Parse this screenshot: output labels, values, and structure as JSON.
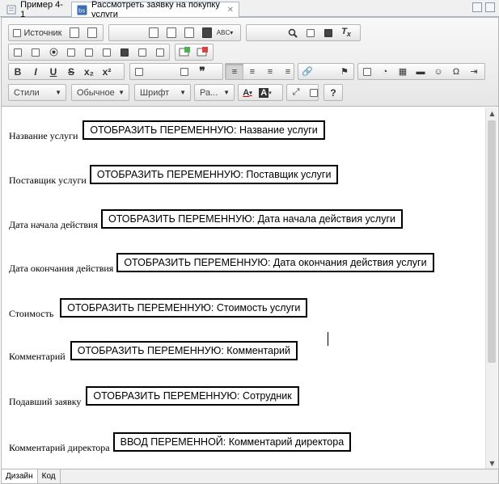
{
  "tabs": [
    {
      "label": "Пример 4-1",
      "active": false
    },
    {
      "label": "Рассмотреть заявку на покупку услуги",
      "active": true
    }
  ],
  "toolbar": {
    "source_label": "Источник",
    "styles_label": "Стили",
    "format_label": "Обычное",
    "font_label": "Шрифт",
    "size_label": "Ра...",
    "bold": "B",
    "italic": "I",
    "underline": "U",
    "strike": "S",
    "subscript": "x₂",
    "superscript": "x²",
    "text_color": "A",
    "bg_color": "A",
    "help": "?",
    "spellcheck": "ABC"
  },
  "form": {
    "rows": [
      {
        "label": "Название услуги",
        "field": "ОТОБРАЗИТЬ ПЕРЕМЕННУЮ: Название услуги"
      },
      {
        "label": "Поставщик услуги",
        "field": "ОТОБРАЗИТЬ ПЕРЕМЕННУЮ: Поставщик услуги"
      },
      {
        "label": "Дата начала действия",
        "field": "ОТОБРАЗИТЬ ПЕРЕМЕННУЮ: Дата начала действия услуги"
      },
      {
        "label": "Дата окончания действия",
        "field": "ОТОБРАЗИТЬ ПЕРЕМЕННУЮ: Дата окончания действия услуги"
      },
      {
        "label": "Стоимость",
        "field": "ОТОБРАЗИТЬ ПЕРЕМЕННУЮ: Стоимость услуги"
      },
      {
        "label": "Комментарий",
        "field": "ОТОБРАЗИТЬ ПЕРЕМЕННУЮ: Комментарий"
      },
      {
        "label": "Подавший заявку",
        "field": "ОТОБРАЗИТЬ ПЕРЕМЕННУЮ: Сотрудник"
      },
      {
        "label": "Комментарий директора",
        "field": "ВВОД ПЕРЕМЕННОЙ: Комментарий директора"
      }
    ]
  },
  "bottom_tabs": [
    {
      "label": "Дизайн",
      "active": true
    },
    {
      "label": "Код",
      "active": false
    }
  ],
  "icons": {
    "tab1": "form-icon",
    "tab2": "bpm-form-icon",
    "close": "close-icon"
  }
}
